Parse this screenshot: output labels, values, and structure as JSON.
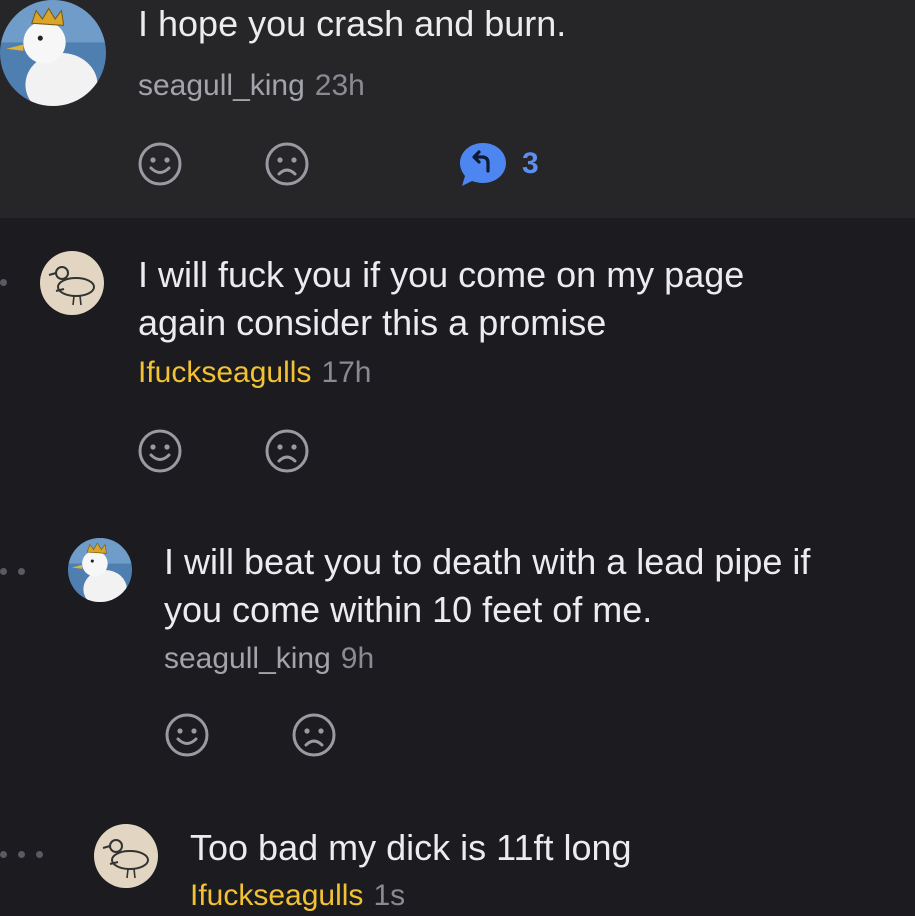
{
  "colors": {
    "background": "#1b1b20",
    "highlight_background": "#262629",
    "text": "#ececef",
    "op_author": "#f2c232",
    "author": "#a3a3ab",
    "timestamp": "#8a8a92",
    "reply_accent": "#4d86f0",
    "reaction_icon": "#9a9aa2"
  },
  "comments": [
    {
      "text_lines": [
        "I hope you crash and burn."
      ],
      "author": "seagull_king",
      "time": "23h",
      "avatar_icon": "seagull-with-crown-avatar",
      "reactions": [
        "smile-icon",
        "frown-icon"
      ],
      "replies": {
        "icon": "reply-bubble-icon",
        "count": "3"
      }
    },
    {
      "text_lines": [
        "I will fuck you if you come on my page",
        "again consider this a promise"
      ],
      "author": "Ifuckseagulls",
      "time": "17h",
      "avatar_icon": "seagull-drawing-avatar",
      "reactions": [
        "smile-icon",
        "frown-icon"
      ]
    },
    {
      "text_lines": [
        "I will beat you to death with a lead pipe if",
        "you come within 10 feet of me."
      ],
      "author": "seagull_king",
      "time": "9h",
      "avatar_icon": "seagull-with-crown-avatar",
      "reactions": [
        "smile-icon",
        "frown-icon"
      ]
    },
    {
      "text_lines": [
        "Too bad my dick is 11ft long"
      ],
      "author": "Ifuckseagulls",
      "time": "1s",
      "avatar_icon": "seagull-drawing-avatar"
    }
  ]
}
